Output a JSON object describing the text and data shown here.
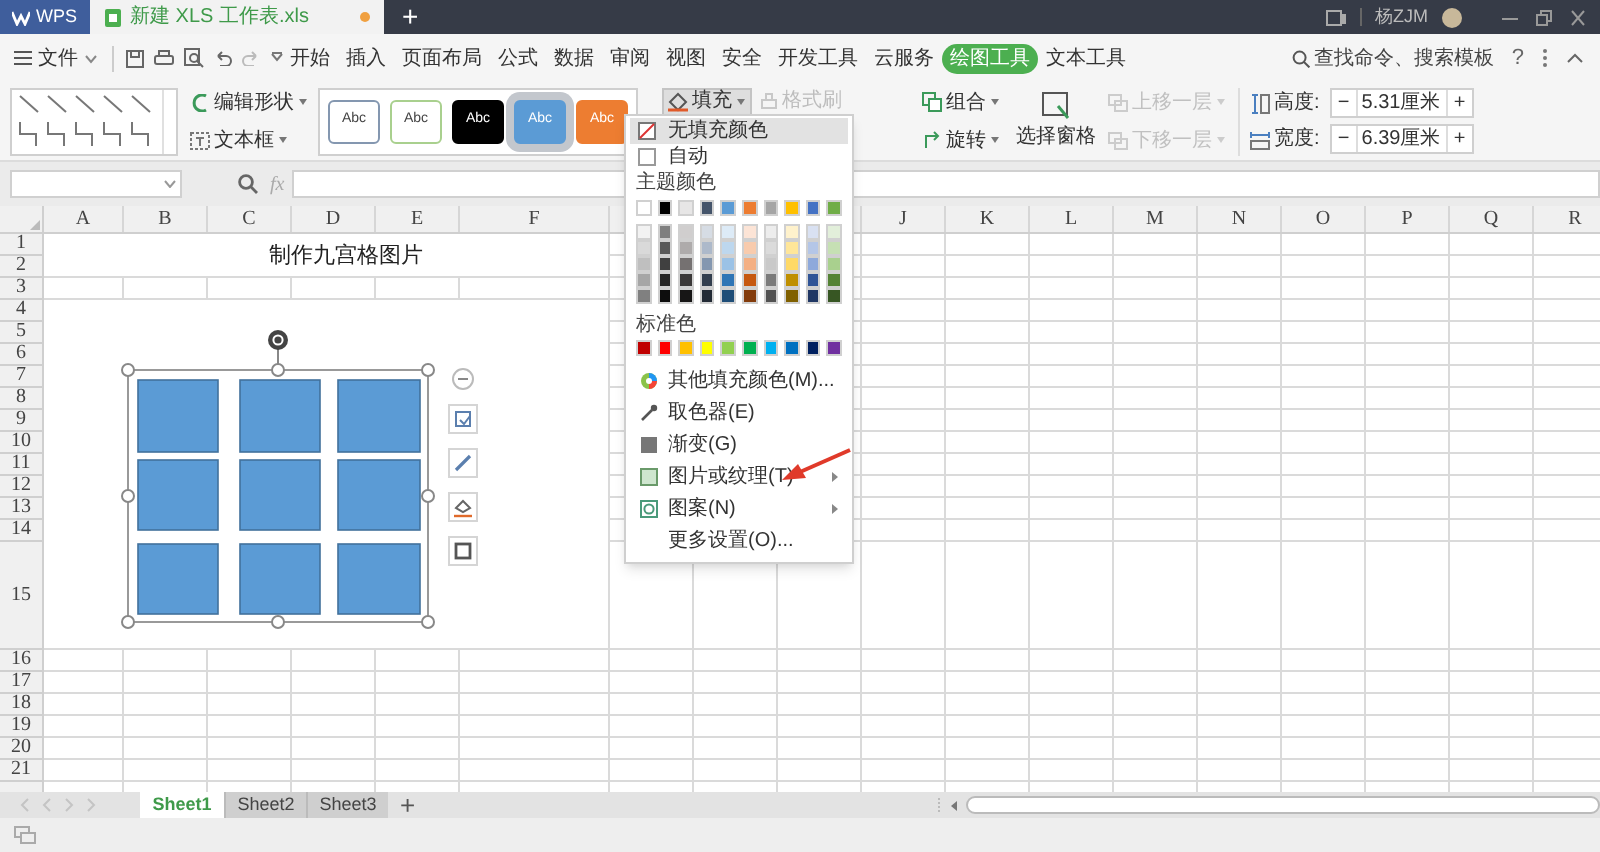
{
  "title_bar": {
    "app_tab": "WPS",
    "document_tab": "新建 XLS 工作表.xls",
    "document_modified": true,
    "new_tab": "+",
    "user": "杨ZJM"
  },
  "menu_bar": {
    "file": "文件",
    "tabs": [
      {
        "label": "开始",
        "selected": false
      },
      {
        "label": "插入",
        "selected": false
      },
      {
        "label": "页面布局",
        "selected": false
      },
      {
        "label": "公式",
        "selected": false
      },
      {
        "label": "数据",
        "selected": false
      },
      {
        "label": "审阅",
        "selected": false
      },
      {
        "label": "视图",
        "selected": false
      },
      {
        "label": "安全",
        "selected": false
      },
      {
        "label": "开发工具",
        "selected": false
      },
      {
        "label": "云服务",
        "selected": false
      },
      {
        "label": "绘图工具",
        "selected": true
      },
      {
        "label": "文本工具",
        "selected": false
      }
    ],
    "search": "查找命令、搜索模板",
    "help": "?"
  },
  "ribbon": {
    "edit_shape": "编辑形状",
    "text_box": "文本框",
    "styles": [
      {
        "label": "Abc",
        "kind": "outline",
        "color": "#8497b0",
        "selected": false
      },
      {
        "label": "Abc",
        "kind": "outline",
        "color": "#a9d08e",
        "selected": false
      },
      {
        "label": "Abc",
        "kind": "filled",
        "color": "#000000",
        "selected": false
      },
      {
        "label": "Abc",
        "kind": "filled",
        "color": "#5b9bd5",
        "selected": true
      },
      {
        "label": "Abc",
        "kind": "filled",
        "color": "#ed7d31",
        "selected": false
      }
    ],
    "fill": "填充",
    "format_painter": {
      "label": "格式刷",
      "disabled": true
    },
    "group": "组合",
    "rotate": "旋转",
    "selection_pane": "选择窗格",
    "bring_forward": {
      "label": "上移一层",
      "disabled": true
    },
    "send_backward": {
      "label": "下移一层",
      "disabled": true
    },
    "height": {
      "label": "高度:",
      "minus": "−",
      "value": "5.31厘米",
      "plus": "+"
    },
    "width": {
      "label": "宽度:",
      "minus": "−",
      "value": "6.39厘米",
      "plus": "+"
    }
  },
  "formula_bar": {
    "fx": "fx"
  },
  "sheet": {
    "columns": [
      {
        "label": "A"
      },
      {
        "label": "B"
      },
      {
        "label": "C"
      },
      {
        "label": "D"
      },
      {
        "label": "E"
      },
      {
        "label": "F"
      },
      {},
      {},
      {},
      {
        "label": "J"
      },
      {
        "label": "K"
      },
      {
        "label": "L"
      },
      {
        "label": "M"
      },
      {
        "label": "N"
      },
      {
        "label": "O"
      },
      {
        "label": "P"
      },
      {
        "label": "Q"
      },
      {
        "label": "R"
      }
    ],
    "rows": [
      "1",
      "2",
      "3",
      "4",
      "5",
      "6",
      "7",
      "8",
      "9",
      "10",
      "11",
      "12",
      "13",
      "14",
      "15",
      "16",
      "17",
      "18",
      "19",
      "20",
      "21"
    ],
    "title": "制作九宫格图片"
  },
  "fill_menu": {
    "no_fill": {
      "label": "无填充颜色",
      "highlighted": true
    },
    "automatic": {
      "label": "自动",
      "highlighted": false
    },
    "theme_heading": "主题颜色",
    "theme_colors": [
      {
        "color": "#ffffff"
      },
      {
        "color": "#000000"
      },
      {
        "color": "#e7e6e6"
      },
      {
        "color": "#44546a"
      },
      {
        "color": "#5b9bd5"
      },
      {
        "color": "#ed7d31"
      },
      {
        "color": "#a5a5a5"
      },
      {
        "color": "#ffc000"
      },
      {
        "color": "#4472c4"
      },
      {
        "color": "#70ad47"
      }
    ],
    "theme_shades": [
      [
        {
          "color": "#f2f2f2"
        },
        {
          "color": "#7f7f7f"
        },
        {
          "color": "#d0cece"
        },
        {
          "color": "#d6dce4"
        },
        {
          "color": "#ddebf7"
        },
        {
          "color": "#fce4d6"
        },
        {
          "color": "#ededed"
        },
        {
          "color": "#fff2cc"
        },
        {
          "color": "#d9e1f2"
        },
        {
          "color": "#e2efda"
        }
      ],
      [
        {
          "color": "#d9d9d9"
        },
        {
          "color": "#595959"
        },
        {
          "color": "#aeabab"
        },
        {
          "color": "#adb9ca"
        },
        {
          "color": "#bdd7ee"
        },
        {
          "color": "#f8cbad"
        },
        {
          "color": "#dbdbdb"
        },
        {
          "color": "#ffe699"
        },
        {
          "color": "#b4c6e7"
        },
        {
          "color": "#c6e0b4"
        }
      ],
      [
        {
          "color": "#bfbfbf"
        },
        {
          "color": "#404040"
        },
        {
          "color": "#757171"
        },
        {
          "color": "#8497b0"
        },
        {
          "color": "#9bc2e6"
        },
        {
          "color": "#f4b084"
        },
        {
          "color": "#c9c9c9"
        },
        {
          "color": "#ffd966"
        },
        {
          "color": "#8ea9db"
        },
        {
          "color": "#a9d08e"
        }
      ],
      [
        {
          "color": "#a6a6a6"
        },
        {
          "color": "#262626"
        },
        {
          "color": "#3a3838"
        },
        {
          "color": "#333f4f"
        },
        {
          "color": "#2f75b5"
        },
        {
          "color": "#c65911"
        },
        {
          "color": "#7b7b7b"
        },
        {
          "color": "#bf8f00"
        },
        {
          "color": "#305496"
        },
        {
          "color": "#548235"
        }
      ],
      [
        {
          "color": "#808080"
        },
        {
          "color": "#0d0d0d"
        },
        {
          "color": "#171616"
        },
        {
          "color": "#222a35"
        },
        {
          "color": "#1f4e78"
        },
        {
          "color": "#833c0c"
        },
        {
          "color": "#525252"
        },
        {
          "color": "#806000"
        },
        {
          "color": "#203764"
        },
        {
          "color": "#375623"
        }
      ]
    ],
    "standard_heading": "标准色",
    "standard_colors": [
      {
        "color": "#c00000"
      },
      {
        "color": "#ff0000"
      },
      {
        "color": "#ffc000"
      },
      {
        "color": "#ffff00"
      },
      {
        "color": "#92d050"
      },
      {
        "color": "#00b050"
      },
      {
        "color": "#00b0f0"
      },
      {
        "color": "#0070c0"
      },
      {
        "color": "#002060"
      },
      {
        "color": "#7030a0"
      }
    ],
    "items": [
      {
        "kind": "palette",
        "label": "其他填充颜色(M)...",
        "submenu": false,
        "highlighted": false
      },
      {
        "kind": "eyedropper",
        "label": "取色器(E)",
        "submenu": false,
        "highlighted": false
      },
      {
        "kind": "gradient",
        "label": "渐变(G)",
        "submenu": false,
        "highlighted": false
      },
      {
        "kind": "texture",
        "label": "图片或纹理(T)",
        "submenu": true,
        "highlighted": false
      },
      {
        "kind": "pattern",
        "label": "图案(N)",
        "submenu": true,
        "highlighted": false
      },
      {
        "kind": "none",
        "label": "更多设置(O)...",
        "submenu": false,
        "highlighted": false
      }
    ]
  },
  "sheet_tabs": {
    "tabs": [
      {
        "label": "Sheet1",
        "selected": true
      },
      {
        "label": "Sheet2",
        "selected": false
      },
      {
        "label": "Sheet3",
        "selected": false
      }
    ],
    "add": "+"
  }
}
